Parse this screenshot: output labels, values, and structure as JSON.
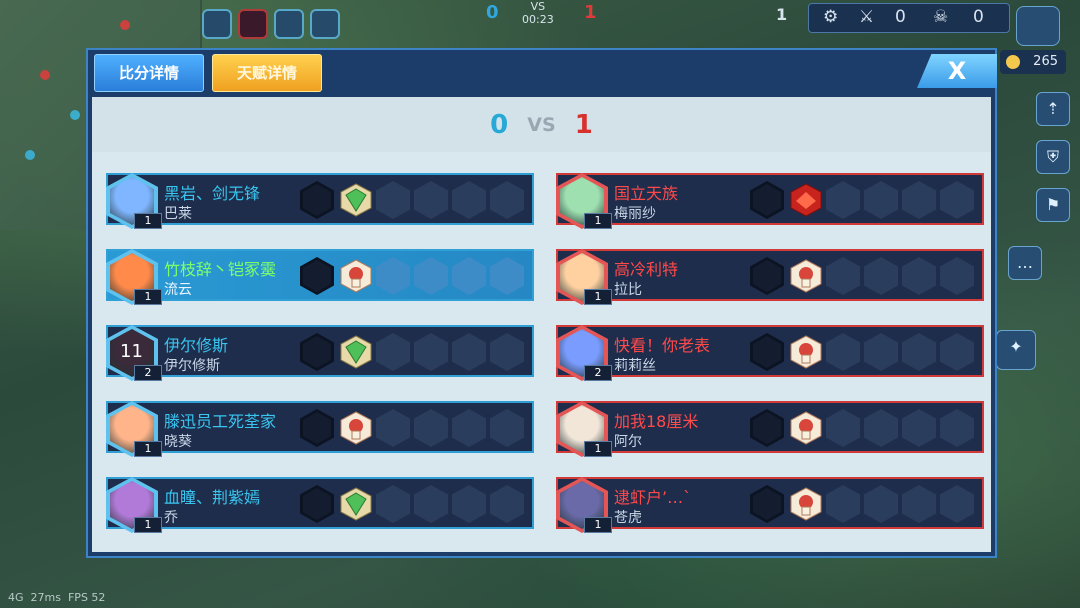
{
  "hud": {
    "score_blue": "0",
    "score_red": "1",
    "vs": "VS",
    "timer": "00:23",
    "left_counter": "1",
    "kills": "0",
    "deaths": "0",
    "gold": "265",
    "status_signal": "4G",
    "status_ping": "27ms",
    "status_fps": "FPS 52"
  },
  "tabs": {
    "score_details": "比分详情",
    "talent_details": "天赋详情"
  },
  "close_label": "X",
  "scoreboard": {
    "blue_score": "0",
    "vs": "VS",
    "red_score": "1"
  },
  "blue_team": [
    {
      "player": "黑岩、剑无锋",
      "hero": "巴莱",
      "level": "1",
      "talent": "green"
    },
    {
      "player": "竹枝辞丶铠冢霙",
      "hero": "流云",
      "level": "1",
      "talent": "red-white",
      "is_self": true
    },
    {
      "player": "伊尔修斯",
      "hero": "伊尔修斯",
      "level": "2",
      "talent": "green",
      "avatar_text": "11"
    },
    {
      "player": "滕迅员工死荃家",
      "hero": "晓葵",
      "level": "1",
      "talent": "red-white"
    },
    {
      "player": "血瞳、荆紫嫣",
      "hero": "乔",
      "level": "1",
      "talent": "green"
    }
  ],
  "red_team": [
    {
      "player": "国立天族",
      "hero": "梅丽纱",
      "level": "1",
      "talent": "red"
    },
    {
      "player": "高冷利特",
      "hero": "拉比",
      "level": "1",
      "talent": "red-white"
    },
    {
      "player": "快看！你老表",
      "hero": "莉莉丝",
      "level": "2",
      "talent": "red-white"
    },
    {
      "player": "加我18厘米",
      "hero": "阿尔",
      "level": "1",
      "talent": "red-white"
    },
    {
      "player": "逮虾户’…`",
      "hero": "苍虎",
      "level": "1",
      "talent": "red-white"
    }
  ],
  "colors": {
    "blue_team": "#2f9fd6",
    "red_team": "#d23a3a",
    "self_highlight": "#2a9ad4",
    "self_name": "#7dff6a"
  }
}
